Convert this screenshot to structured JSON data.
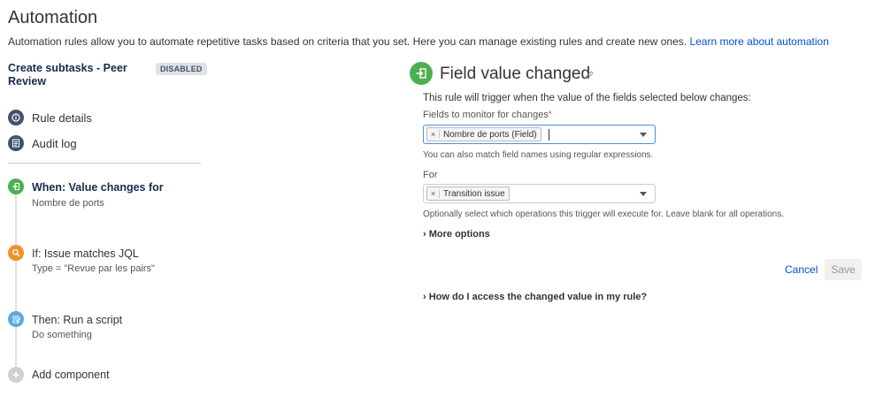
{
  "header": {
    "title": "Automation",
    "intro": "Automation rules allow you to automate repetitive tasks based on criteria that you set. Here you can manage existing rules and create new ones.",
    "learn_more": "Learn more about automation"
  },
  "rule": {
    "name": "Create subtasks - Peer Review",
    "status": "DISABLED"
  },
  "nav": [
    {
      "label": "Rule details",
      "icon": "info-icon"
    },
    {
      "label": "Audit log",
      "icon": "list-icon"
    }
  ],
  "steps": [
    {
      "title": "When: Value changes for",
      "subtitle": "Nombre de ports",
      "icon": "enter-icon",
      "color": "#4caf50"
    },
    {
      "title": "If: Issue matches JQL",
      "subtitle": "Type = \"Revue par les pairs\"",
      "icon": "search-icon",
      "color": "#f0922b"
    },
    {
      "title": "Then: Run a script",
      "subtitle": "Do something",
      "icon": "script-icon",
      "color": "#5aa9e6"
    },
    {
      "title": "Add component",
      "icon": "plus-icon",
      "color": "#ccc"
    }
  ],
  "panel": {
    "title": "Field value changed",
    "description": "This rule will trigger when the value of the fields selected below changes:",
    "fields_label": "Fields to monitor for changes",
    "fields_required": "*",
    "fields_chip": "Nombre de ports (Field)",
    "fields_help": "You can also match field names using regular expressions.",
    "for_label": "For",
    "for_chip": "Transition issue",
    "for_help": "Optionally select which operations this trigger will execute for. Leave blank for all operations.",
    "more_options": "More options",
    "cancel": "Cancel",
    "save": "Save",
    "faq": "How do I access the changed value in my rule?"
  },
  "colors": {
    "accent": "#0052cc",
    "trigger": "#4caf50",
    "focus": "#4a90e2"
  }
}
